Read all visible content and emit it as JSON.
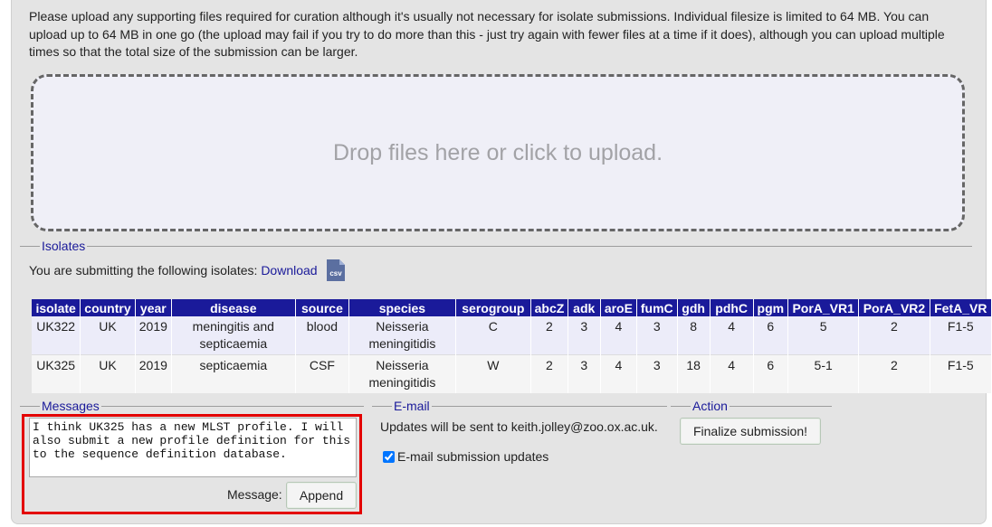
{
  "intro": {
    "text": "Please upload any supporting files required for curation although it's usually not necessary for isolate submissions. Individual filesize is limited to 64 MB. You can upload up to 64 MB in one go (the upload may fail if you try to do more than this - just try again with fewer files at a time if it does), although you can upload multiple times so that the total size of the submission can be larger."
  },
  "dropzone": {
    "text": "Drop files here or click to upload."
  },
  "isolates": {
    "legend": "Isolates",
    "submitting_text": "You are submitting the following isolates: ",
    "download_label": "Download",
    "csv_icon_label": "csv",
    "columns": [
      "isolate",
      "country",
      "year",
      "disease",
      "source",
      "species",
      "serogroup",
      "abcZ",
      "adk",
      "aroE",
      "fumC",
      "gdh",
      "pdhC",
      "pgm",
      "PorA_VR1",
      "PorA_VR2",
      "FetA_VR"
    ],
    "rows": [
      [
        "UK322",
        "UK",
        "2019",
        "meningitis and septicaemia",
        "blood",
        "Neisseria meningitidis",
        "C",
        "2",
        "3",
        "4",
        "3",
        "8",
        "4",
        "6",
        "5",
        "2",
        "F1-5"
      ],
      [
        "UK325",
        "UK",
        "2019",
        "septicaemia",
        "CSF",
        "Neisseria meningitidis",
        "W",
        "2",
        "3",
        "4",
        "3",
        "18",
        "4",
        "6",
        "5-1",
        "2",
        "F1-5"
      ]
    ]
  },
  "messages": {
    "legend": "Messages",
    "textarea_value": "I think UK325 has a new MLST profile. I will also submit a new profile definition for this to the sequence definition database.",
    "message_label": "Message:",
    "append_label": "Append"
  },
  "email": {
    "legend": "E-mail",
    "updates_text": "Updates will be sent to keith.jolley@zoo.ox.ac.uk.",
    "checkbox_label": "E-mail submission updates",
    "checked": true
  },
  "action": {
    "legend": "Action",
    "finalize_label": "Finalize submission!"
  },
  "colors": {
    "accent": "#1a1a9a",
    "highlight_border": "#e30000",
    "panel_bg": "#e4e4e4"
  }
}
